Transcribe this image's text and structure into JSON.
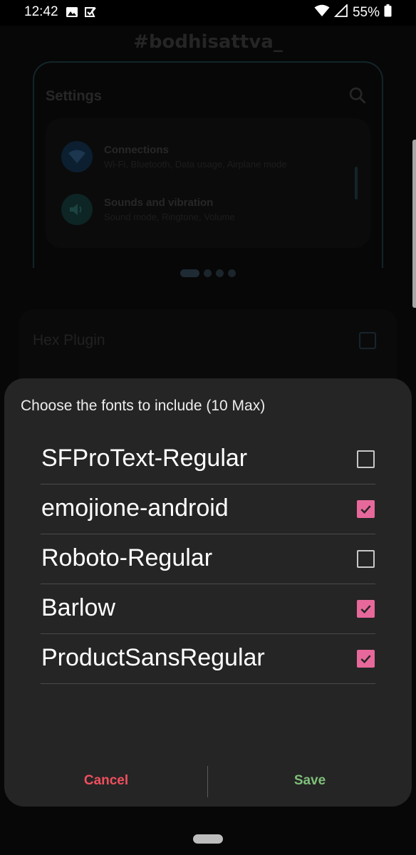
{
  "status_bar": {
    "time": "12:42",
    "battery": "55%",
    "icons": [
      "image-icon",
      "check-box-notification-icon",
      "wifi-icon",
      "cell-signal-icon",
      "battery-icon"
    ]
  },
  "background": {
    "app_title": "#bodhisattva_",
    "preview": {
      "title": "Settings",
      "items": [
        {
          "title": "Connections",
          "subtitle": "Wi-Fi, Bluetooth, Data usage, Airplane mode",
          "icon": "wifi-icon"
        },
        {
          "title": "Sounds and vibration",
          "subtitle": "Sound mode, Ringtone, Volume",
          "icon": "volume-icon"
        }
      ]
    },
    "list": {
      "hex_plugin_label": "Hex Plugin"
    }
  },
  "dialog": {
    "title": "Choose the fonts to include (10 Max)",
    "fonts": [
      {
        "name": "SFProText-Regular",
        "checked": false
      },
      {
        "name": "emojione-android",
        "checked": true
      },
      {
        "name": "Roboto-Regular",
        "checked": false
      },
      {
        "name": "Barlow",
        "checked": true
      },
      {
        "name": "ProductSansRegular",
        "checked": true
      }
    ],
    "cancel_label": "Cancel",
    "save_label": "Save"
  },
  "colors": {
    "accent_check": "#e7689a",
    "cancel": "#ef4f5e",
    "save": "#7fbf7a",
    "dialog_bg": "#252525"
  }
}
